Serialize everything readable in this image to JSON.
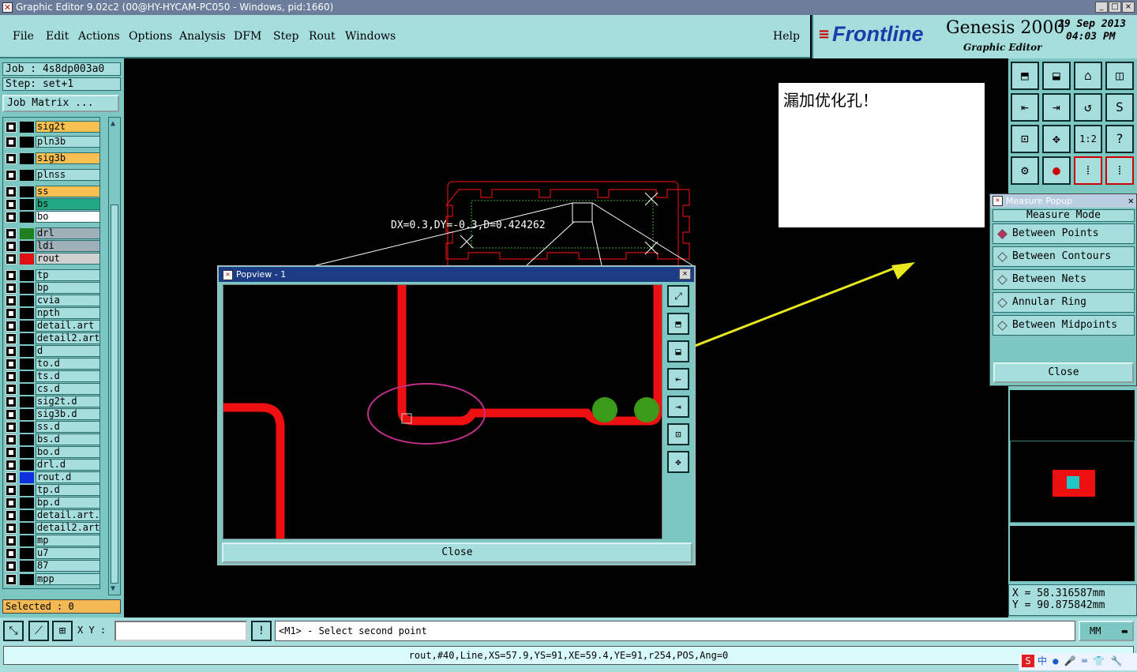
{
  "window": {
    "title": "Graphic Editor 9.02c2 (00@HY-HYCAM-PC050 - Windows, pid:1660)",
    "buttons": [
      "_",
      "□",
      "×"
    ]
  },
  "menu": [
    {
      "label": "File"
    },
    {
      "label": "Edit"
    },
    {
      "label": "Actions"
    },
    {
      "label": "Options"
    },
    {
      "label": "Analysis"
    },
    {
      "label": "DFM"
    },
    {
      "label": "Step"
    },
    {
      "label": "Rout"
    },
    {
      "label": "Windows"
    },
    {
      "label": "Help"
    }
  ],
  "brand": {
    "logo": "Frontline",
    "product": "Genesis 2000",
    "subtitle": "Graphic Editor",
    "date": "29  Sep  2013",
    "time": "04:03  PM"
  },
  "job": {
    "job": "Job :  4s8dp003a0",
    "step": "Step:  set+1",
    "matrix_button": "Job Matrix ...",
    "selected": "Selected : 0"
  },
  "layers": [
    {
      "name": "sig2t",
      "color": "#000000",
      "bg": "#f8c050"
    },
    {
      "name": "pln3b",
      "color": "#000000",
      "bg": "#a6dede"
    },
    {
      "name": "sig3b",
      "color": "#000000",
      "bg": "#f8c050"
    },
    {
      "name": "plnss",
      "color": "#000000",
      "bg": "#a6dede"
    },
    {
      "name": "ss",
      "color": "#000000",
      "bg": "#f8c050"
    },
    {
      "name": "bs",
      "color": "#000000",
      "bg": "#20a882"
    },
    {
      "name": "bo",
      "color": "#000000",
      "bg": "#ffffff"
    },
    {
      "name": "drl",
      "color": "#208020",
      "bg": "#a0b0b8"
    },
    {
      "name": "ldi",
      "color": "#000000",
      "bg": "#a0b0b8"
    },
    {
      "name": "rout",
      "color": "#e01010",
      "bg": "#d0d0d0"
    },
    {
      "name": "tp",
      "color": "#000000",
      "bg": "#a6dede"
    },
    {
      "name": "bp",
      "color": "#000000",
      "bg": "#a6dede"
    },
    {
      "name": "cvia",
      "color": "#000000",
      "bg": "#a6dede"
    },
    {
      "name": "npth",
      "color": "#000000",
      "bg": "#a6dede"
    },
    {
      "name": "detail.art",
      "color": "#000000",
      "bg": "#a6dede"
    },
    {
      "name": "detail2.art",
      "color": "#000000",
      "bg": "#a6dede"
    },
    {
      "name": "d",
      "color": "#000000",
      "bg": "#a6dede"
    },
    {
      "name": "to.d",
      "color": "#000000",
      "bg": "#a6dede"
    },
    {
      "name": "ts.d",
      "color": "#000000",
      "bg": "#a6dede"
    },
    {
      "name": "cs.d",
      "color": "#000000",
      "bg": "#a6dede"
    },
    {
      "name": "sig2t.d",
      "color": "#000000",
      "bg": "#a6dede"
    },
    {
      "name": "sig3b.d",
      "color": "#000000",
      "bg": "#a6dede"
    },
    {
      "name": "ss.d",
      "color": "#000000",
      "bg": "#a6dede"
    },
    {
      "name": "bs.d",
      "color": "#000000",
      "bg": "#a6dede"
    },
    {
      "name": "bo.d",
      "color": "#000000",
      "bg": "#a6dede"
    },
    {
      "name": "drl.d",
      "color": "#000000",
      "bg": "#a6dede"
    },
    {
      "name": "rout.d",
      "color": "#1030e0",
      "bg": "#a6dede"
    },
    {
      "name": "tp.d",
      "color": "#000000",
      "bg": "#a6dede"
    },
    {
      "name": "bp.d",
      "color": "#000000",
      "bg": "#a6dede"
    },
    {
      "name": "detail.art.d",
      "color": "#000000",
      "bg": "#a6dede"
    },
    {
      "name": "detail2.art",
      "color": "#000000",
      "bg": "#a6dede"
    },
    {
      "name": "mp",
      "color": "#000000",
      "bg": "#a6dede"
    },
    {
      "name": "u7",
      "color": "#000000",
      "bg": "#a6dede"
    },
    {
      "name": "87",
      "color": "#000000",
      "bg": "#a6dede"
    },
    {
      "name": "mpp",
      "color": "#000000",
      "bg": "#a6dede"
    }
  ],
  "measure_readout": "DX=0.3,DY=-0.3,D=0.424262",
  "note": "漏加优化孔！",
  "popview": {
    "title": "Popview - 1",
    "close": "Close"
  },
  "measure_popup": {
    "title": "Measure Popup",
    "mode_label": "Measure Mode",
    "options": [
      {
        "label": "Between Points",
        "selected": true
      },
      {
        "label": "Between Contours",
        "selected": false
      },
      {
        "label": "Between Nets",
        "selected": false
      },
      {
        "label": "Annular Ring",
        "selected": false
      },
      {
        "label": "Between Midpoints",
        "selected": false
      }
    ],
    "close": "Close"
  },
  "coords": {
    "x": "X  =  58.316587mm",
    "y": "Y  =  90.875842mm"
  },
  "prompt": {
    "xy_label": "X Y :",
    "xy_value": "",
    "message": "<M1> - Select second point",
    "units": "MM"
  },
  "status": "rout,#40,Line,XS=57.9,YS=91,XE=59.4,YE=91,r254,POS,Ang=0",
  "tray": {
    "ime": "中"
  }
}
